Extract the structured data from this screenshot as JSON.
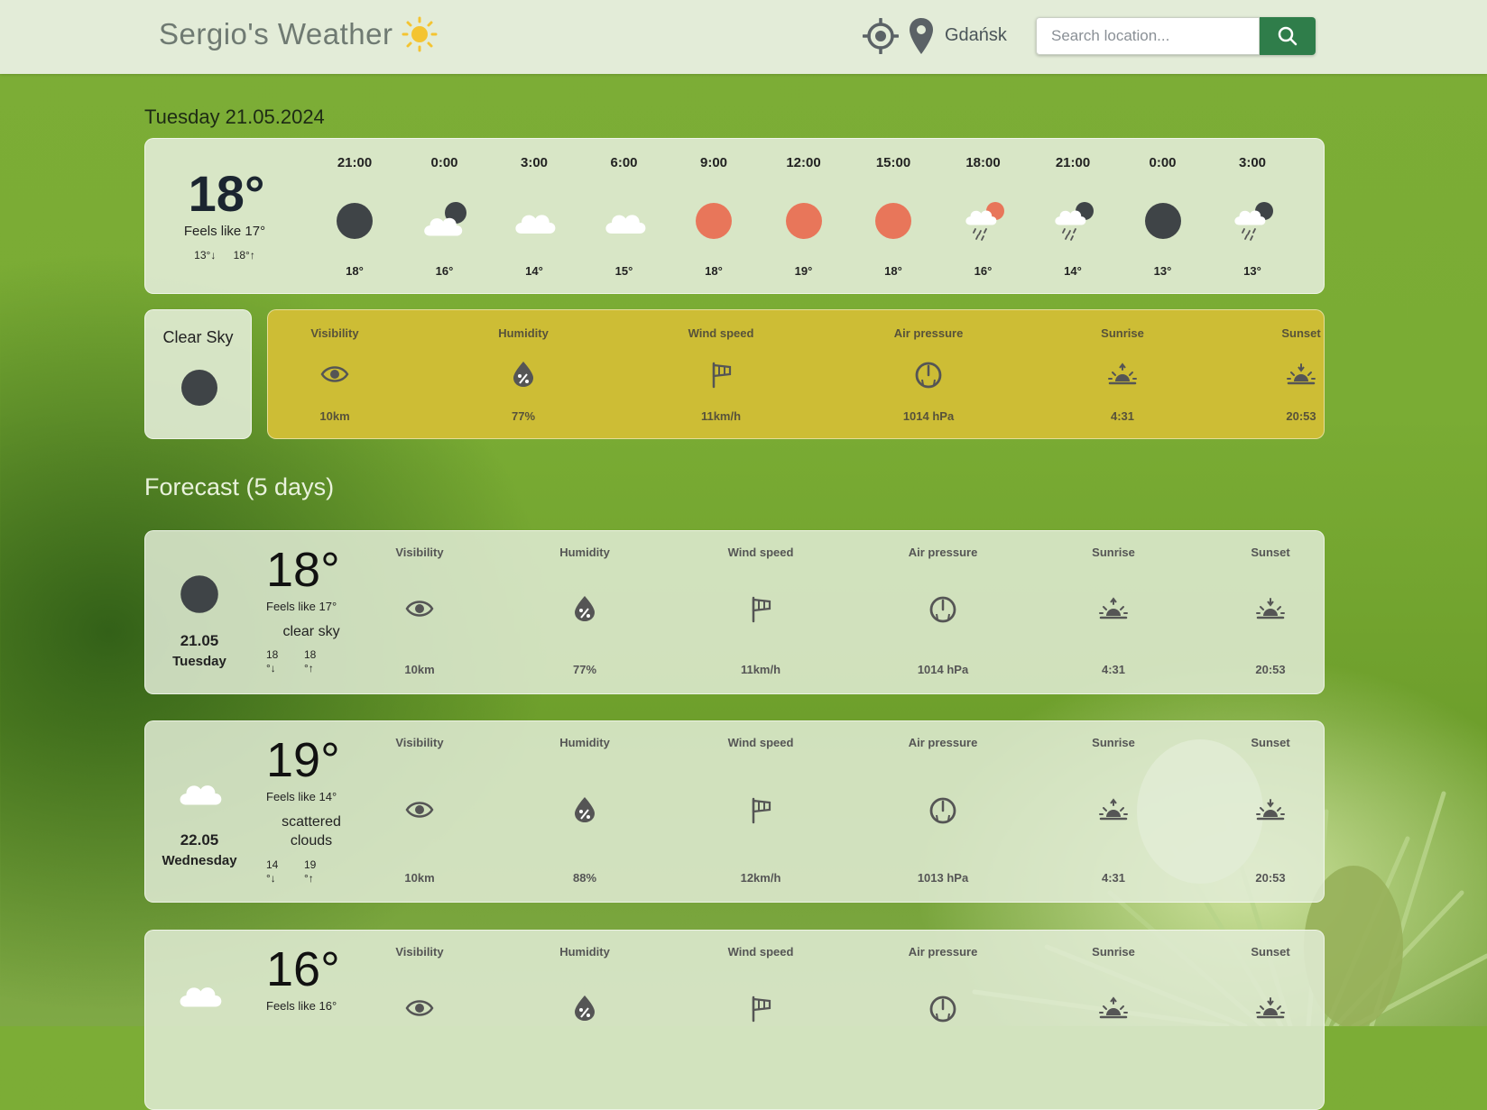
{
  "header": {
    "title": "Sergio's Weather",
    "location": "Gdańsk",
    "search_placeholder": "Search location..."
  },
  "today": {
    "date": "Tuesday 21.05.2024",
    "temp": "18°",
    "feels_like": "Feels like 17°",
    "min": "13°↓",
    "max": "18°↑",
    "condition": "Clear Sky",
    "condition_icon": "night-clear-icon",
    "hourly": [
      {
        "time": "21:00",
        "temp": "18°",
        "icon": "night-clear-icon"
      },
      {
        "time": "0:00",
        "temp": "16°",
        "icon": "night-cloudy-icon"
      },
      {
        "time": "3:00",
        "temp": "14°",
        "icon": "cloud-icon"
      },
      {
        "time": "6:00",
        "temp": "15°",
        "icon": "cloud-icon"
      },
      {
        "time": "9:00",
        "temp": "18°",
        "icon": "sun-icon"
      },
      {
        "time": "12:00",
        "temp": "19°",
        "icon": "sun-icon"
      },
      {
        "time": "15:00",
        "temp": "18°",
        "icon": "sun-icon"
      },
      {
        "time": "18:00",
        "temp": "16°",
        "icon": "day-rain-icon"
      },
      {
        "time": "21:00",
        "temp": "14°",
        "icon": "night-rain-icon"
      },
      {
        "time": "0:00",
        "temp": "13°",
        "icon": "night-clear-icon"
      },
      {
        "time": "3:00",
        "temp": "13°",
        "icon": "night-rain-icon"
      }
    ],
    "details": [
      {
        "label": "Visibility",
        "value": "10km",
        "icon": "eye-icon"
      },
      {
        "label": "Humidity",
        "value": "77%",
        "icon": "humidity-drop-icon"
      },
      {
        "label": "Wind speed",
        "value": "11km/h",
        "icon": "wind-flag-icon"
      },
      {
        "label": "Air pressure",
        "value": "1014 hPa",
        "icon": "gauge-icon"
      },
      {
        "label": "Sunrise",
        "value": "4:31",
        "icon": "sunrise-icon"
      },
      {
        "label": "Sunset",
        "value": "20:53",
        "icon": "sunset-icon"
      }
    ]
  },
  "forecast": {
    "heading": "Forecast (5 days)",
    "days": [
      {
        "date": "21.05",
        "day": "Tuesday",
        "temp": "18°",
        "feels_like": "Feels like 17°",
        "description": "clear sky",
        "min": "18",
        "min_unit": "°↓",
        "max": "18",
        "max_unit": "°↑",
        "icon": "night-clear-icon",
        "details": [
          {
            "label": "Visibility",
            "value": "10km"
          },
          {
            "label": "Humidity",
            "value": "77%"
          },
          {
            "label": "Wind speed",
            "value": "11km/h"
          },
          {
            "label": "Air pressure",
            "value": "1014 hPa"
          },
          {
            "label": "Sunrise",
            "value": "4:31"
          },
          {
            "label": "Sunset",
            "value": "20:53"
          }
        ]
      },
      {
        "date": "22.05",
        "day": "Wednesday",
        "temp": "19°",
        "feels_like": "Feels like 14°",
        "description": "scattered clouds",
        "min": "14",
        "min_unit": "°↓",
        "max": "19",
        "max_unit": "°↑",
        "icon": "cloud-icon",
        "details": [
          {
            "label": "Visibility",
            "value": "10km"
          },
          {
            "label": "Humidity",
            "value": "88%"
          },
          {
            "label": "Wind speed",
            "value": "12km/h"
          },
          {
            "label": "Air pressure",
            "value": "1013 hPa"
          },
          {
            "label": "Sunrise",
            "value": "4:31"
          },
          {
            "label": "Sunset",
            "value": "20:53"
          }
        ]
      },
      {
        "temp": "16°",
        "feels_like": "Feels like 16°",
        "icon": "cloud-icon",
        "details": [
          {
            "label": "Visibility"
          },
          {
            "label": "Humidity"
          },
          {
            "label": "Wind speed"
          },
          {
            "label": "Air pressure"
          },
          {
            "label": "Sunrise"
          },
          {
            "label": "Sunset"
          }
        ]
      }
    ]
  },
  "colors": {
    "header_bg": "#e3ecd8",
    "search_button": "#2f7d4a",
    "details_bg": "#cdbd35",
    "sun": "#e8765a",
    "moon": "#3f4447"
  }
}
